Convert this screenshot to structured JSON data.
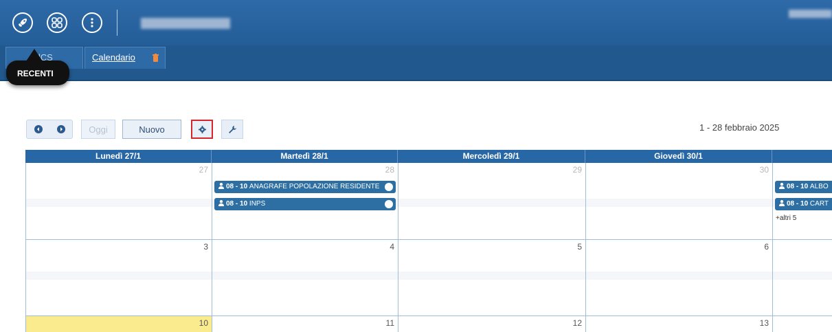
{
  "header": {
    "launcher_icon": "rocket-icon",
    "apps_icon": "grid-apps-icon",
    "more_icon": "more-vertical-icon"
  },
  "tabs": {
    "home_label": "ilCS Home",
    "calendar_label": "Calendario",
    "recent_label": "RECENTI"
  },
  "toolbar": {
    "today_label": "Oggi",
    "new_label": "Nuovo",
    "range_label": "1 - 28 febbraio 2025"
  },
  "calendar": {
    "headers": [
      "Lunedì 27/1",
      "Martedì 28/1",
      "Mercoledì 29/1",
      "Giovedì 30/1",
      ""
    ],
    "week1": {
      "days": [
        "27",
        "28",
        "29",
        "30",
        ""
      ],
      "events_tue": [
        {
          "time": "08 - 10",
          "title": "ANAGRAFE POPOLAZIONE RESIDENTE"
        },
        {
          "time": "08 - 10",
          "title": "INPS"
        }
      ],
      "events_fri": [
        {
          "time": "08 - 10",
          "title": "ALBO"
        },
        {
          "time": "08 - 10",
          "title": "CART"
        }
      ],
      "more_fri": "+altri 5"
    },
    "week2": {
      "days": [
        "3",
        "4",
        "5",
        "6",
        ""
      ]
    },
    "week3": {
      "days": [
        "10",
        "11",
        "12",
        "13",
        ""
      ]
    }
  },
  "colors": {
    "brand": "#2867a6",
    "event": "#2d6fa3",
    "today": "#faeb8f",
    "highlight": "#d6242c"
  }
}
